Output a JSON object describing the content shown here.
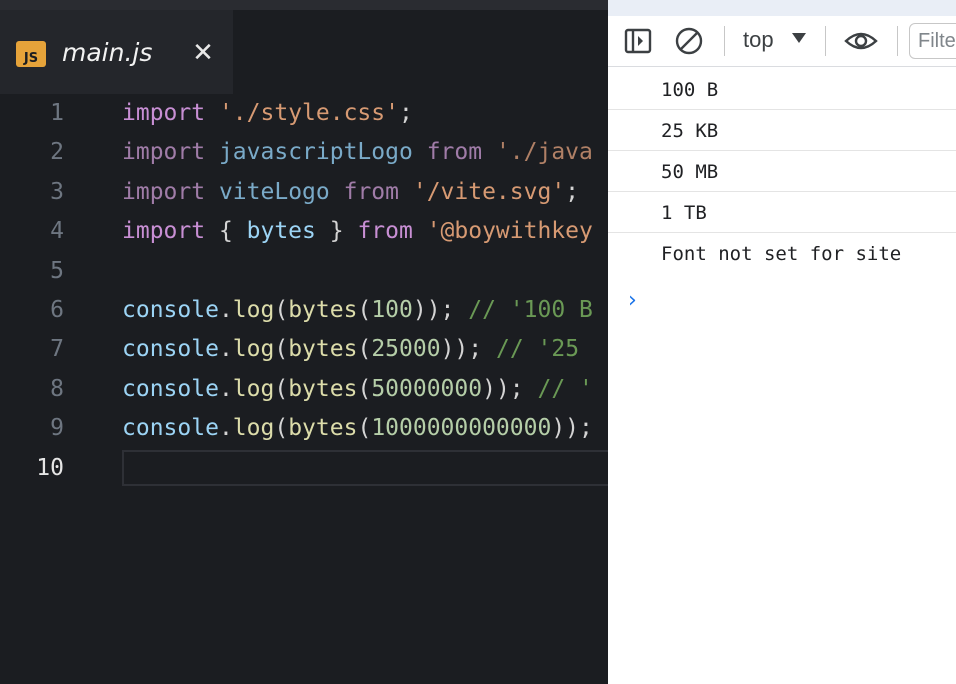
{
  "editor": {
    "tab": {
      "icon_label": "JS",
      "title": "main.js",
      "close": "✕"
    },
    "lines": [
      {
        "n": "1",
        "tokens": [
          [
            "kw",
            "import"
          ],
          [
            "punct",
            " "
          ],
          [
            "str",
            "'./style.css'"
          ],
          [
            "punct",
            ";"
          ]
        ]
      },
      {
        "n": "2",
        "tokens": [
          [
            "dim-kw",
            "import"
          ],
          [
            "punct",
            " "
          ],
          [
            "dim-id",
            "javascriptLogo"
          ],
          [
            "punct",
            " "
          ],
          [
            "dim-kw",
            "from"
          ],
          [
            "punct",
            " "
          ],
          [
            "dim-str",
            "'./java"
          ]
        ]
      },
      {
        "n": "3",
        "tokens": [
          [
            "dim-kw",
            "import"
          ],
          [
            "punct",
            " "
          ],
          [
            "dim-id",
            "viteLogo"
          ],
          [
            "punct",
            " "
          ],
          [
            "dim-kw",
            "from"
          ],
          [
            "punct",
            " "
          ],
          [
            "str",
            "'/vite.svg'"
          ],
          [
            "punct",
            ";"
          ]
        ]
      },
      {
        "n": "4",
        "tokens": [
          [
            "kw",
            "import"
          ],
          [
            "punct",
            " { "
          ],
          [
            "id",
            "bytes"
          ],
          [
            "punct",
            " } "
          ],
          [
            "kw",
            "from"
          ],
          [
            "punct",
            " "
          ],
          [
            "str",
            "'@boywithkey"
          ]
        ]
      },
      {
        "n": "5",
        "tokens": []
      },
      {
        "n": "6",
        "tokens": [
          [
            "id",
            "console"
          ],
          [
            "punct",
            "."
          ],
          [
            "fn",
            "log"
          ],
          [
            "punct",
            "("
          ],
          [
            "fn",
            "bytes"
          ],
          [
            "punct",
            "("
          ],
          [
            "num",
            "100"
          ],
          [
            "punct",
            "));"
          ],
          [
            "punct",
            " "
          ],
          [
            "com",
            "// '100 B"
          ]
        ]
      },
      {
        "n": "7",
        "tokens": [
          [
            "id",
            "console"
          ],
          [
            "punct",
            "."
          ],
          [
            "fn",
            "log"
          ],
          [
            "punct",
            "("
          ],
          [
            "fn",
            "bytes"
          ],
          [
            "punct",
            "("
          ],
          [
            "num",
            "25000"
          ],
          [
            "punct",
            "));"
          ],
          [
            "punct",
            " "
          ],
          [
            "com",
            "// '25"
          ]
        ]
      },
      {
        "n": "8",
        "tokens": [
          [
            "id",
            "console"
          ],
          [
            "punct",
            "."
          ],
          [
            "fn",
            "log"
          ],
          [
            "punct",
            "("
          ],
          [
            "fn",
            "bytes"
          ],
          [
            "punct",
            "("
          ],
          [
            "num",
            "50000000"
          ],
          [
            "punct",
            "));"
          ],
          [
            "punct",
            " "
          ],
          [
            "com",
            "// '"
          ]
        ]
      },
      {
        "n": "9",
        "tokens": [
          [
            "id",
            "console"
          ],
          [
            "punct",
            "."
          ],
          [
            "fn",
            "log"
          ],
          [
            "punct",
            "("
          ],
          [
            "fn",
            "bytes"
          ],
          [
            "punct",
            "("
          ],
          [
            "num",
            "1000000000000"
          ],
          [
            "punct",
            "));"
          ]
        ]
      },
      {
        "n": "10",
        "tokens": [],
        "active": true
      }
    ]
  },
  "devtools": {
    "toolbar": {
      "context": "top",
      "filter_placeholder": "Filter"
    },
    "console": {
      "messages": [
        "100 B",
        "25 KB",
        "50 MB",
        "1 TB",
        "Font not set for site"
      ],
      "prompt": "›"
    }
  },
  "colors": {
    "editor_bg": "#1b1d21",
    "keyword": "#c88fd4",
    "string": "#d79a73",
    "identifier": "#9cd4f5",
    "function": "#dcdcaa",
    "number": "#b5cea8",
    "comment": "#6a9955",
    "js_icon": "#e6a33a",
    "prompt_blue": "#1a73e8"
  }
}
